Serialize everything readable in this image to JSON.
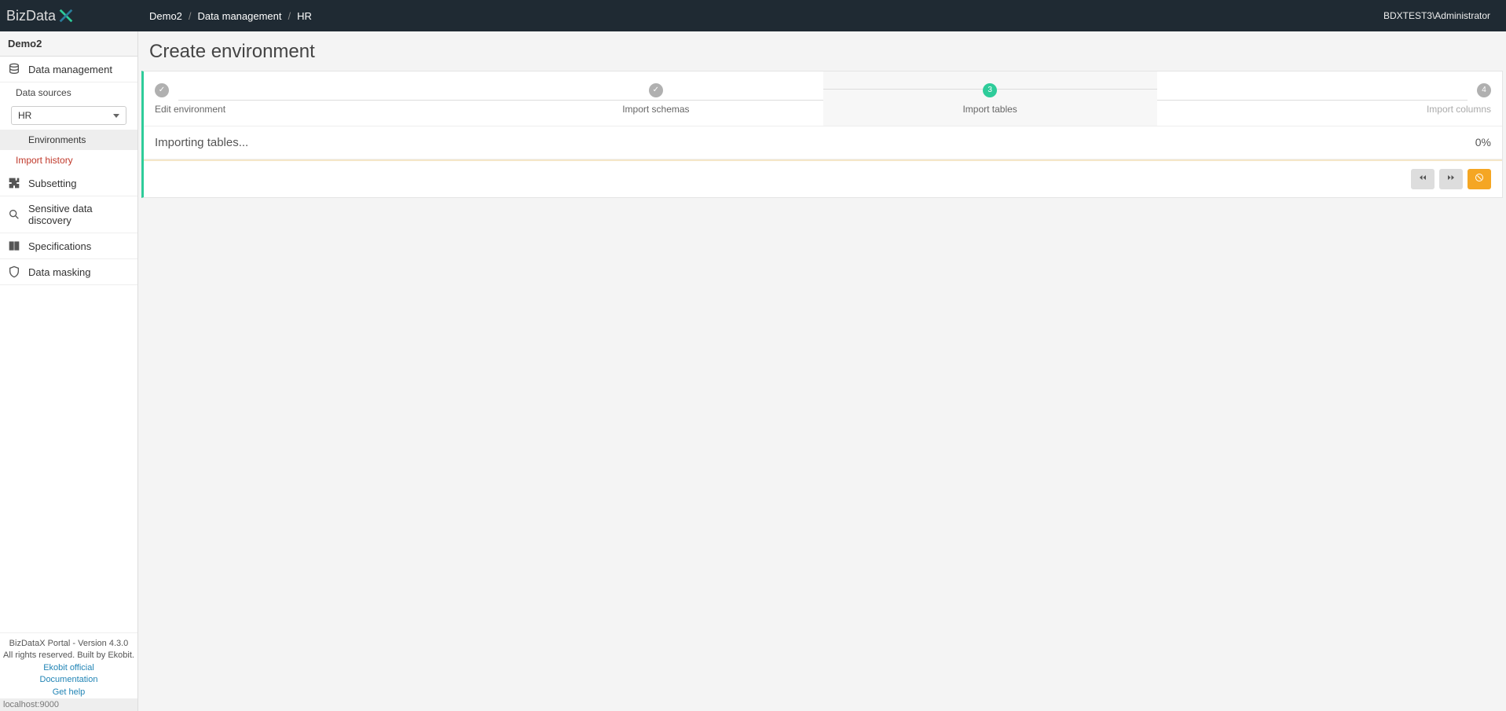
{
  "header": {
    "logo_text": "BizData",
    "user": "BDXTEST3\\Administrator"
  },
  "breadcrumb": {
    "items": [
      "Demo2",
      "Data management",
      "HR"
    ],
    "sep": "/"
  },
  "sidebar": {
    "project": "Demo2",
    "data_management": "Data management",
    "data_sources": "Data sources",
    "selected_source": "HR",
    "environments": "Environments",
    "import_history": "Import history",
    "subsetting": "Subsetting",
    "sensitive_discovery": "Sensitive data discovery",
    "specifications": "Specifications",
    "data_masking": "Data masking",
    "footer": {
      "line1": "BizDataX Portal - Version 4.3.0",
      "line2": "All rights reserved. Built by Ekobit.",
      "link1": "Ekobit official",
      "link2": "Documentation",
      "link3": "Get help",
      "status_url": "localhost:9000"
    }
  },
  "main": {
    "title": "Create environment",
    "steps": [
      {
        "label": "Edit environment",
        "state": "done",
        "mark": "✓"
      },
      {
        "label": "Import schemas",
        "state": "done",
        "mark": "✓"
      },
      {
        "label": "Import tables",
        "state": "active",
        "mark": "3"
      },
      {
        "label": "Import columns",
        "state": "pending",
        "mark": "4"
      }
    ],
    "progress": {
      "label": "Importing tables...",
      "pct": "0%"
    }
  }
}
